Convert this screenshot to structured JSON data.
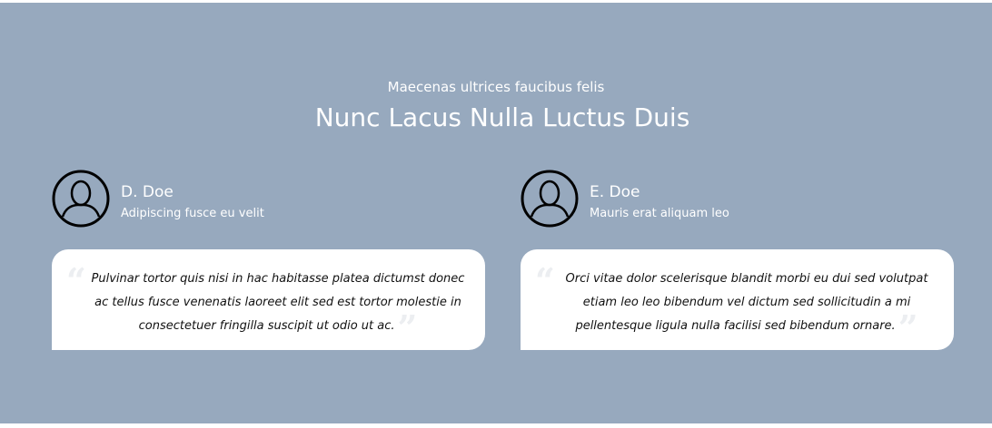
{
  "header": {
    "subtitle": "Maecenas ultrices faucibus felis",
    "title": "Nunc Lacus Nulla Luctus Duis"
  },
  "testimonials": [
    {
      "name": "D. Doe",
      "role": "Adipiscing fusce eu velit",
      "quote": "Pulvinar tortor quis nisi in hac habitasse platea dictumst donec ac tellus fusce venenatis laoreet elit sed est tortor molestie in consectetuer fringilla suscipit ut odio ut ac.",
      "avatar_icon": "user-avatar-icon"
    },
    {
      "name": "E. Doe",
      "role": "Mauris erat aliquam leo",
      "quote": "Orci vitae dolor scelerisque blandit morbi eu dui sed volutpat etiam leo leo bibendum vel dictum sed sollicitudin a mi pellentesque ligula nulla facilisi sed bibendum ornare.",
      "avatar_icon": "user-avatar-icon"
    }
  ],
  "quote_marks": {
    "open": "“",
    "close": "”"
  },
  "colors": {
    "section_bg": "#97a9be",
    "text_on_bg": "#ffffff",
    "quote_box": "#ffffff",
    "quote_marks": "#eceef1"
  }
}
